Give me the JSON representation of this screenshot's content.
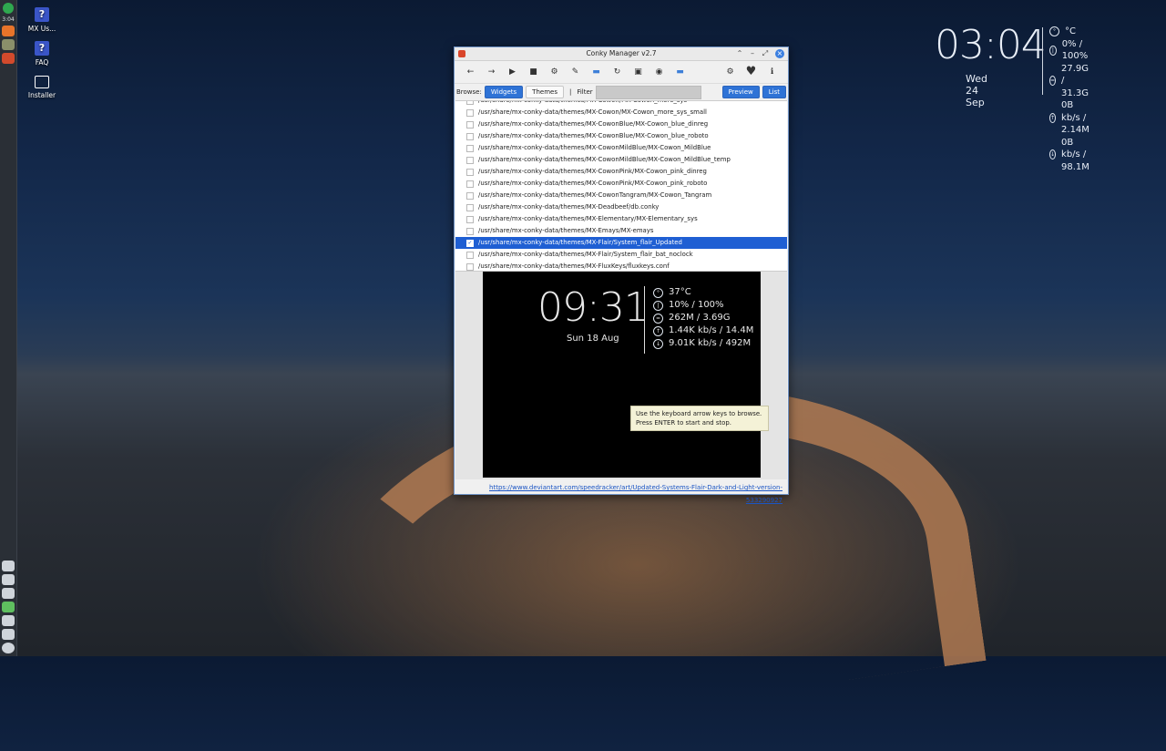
{
  "panel": {
    "clock": "3:04"
  },
  "desktop_icons": [
    {
      "label": "MX Us...",
      "glyph": "?"
    },
    {
      "label": "FAQ",
      "glyph": "?"
    },
    {
      "label": "Installer",
      "glyph": "installer-icon"
    }
  ],
  "conky": {
    "time": "03:04",
    "date": "Wed 24 Sep",
    "rows": [
      "°C",
      "0% / 100%",
      "27.9G / 31.3G",
      "0B kb/s / 2.14M",
      "0B kb/s / 98.1M"
    ]
  },
  "window": {
    "title": "Conky Manager v2.7",
    "browse_label": "Browse:",
    "widgets_label": "Widgets",
    "themes_label": "Themes",
    "separator": "|",
    "filter_label": "Filter",
    "filter_value": "",
    "preview_label": "Preview",
    "list_label": "List",
    "url": "https://www.deviantart.com/speedracker/art/Updated-Systems-Flair-Dark-and-Light-version-533290927",
    "themes": [
      {
        "path": "/usr/share/mx-conky-data/themes/MX-Cowon/MX-Cowon_more_sys",
        "checked": false
      },
      {
        "path": "/usr/share/mx-conky-data/themes/MX-Cowon/MX-Cowon_more_sys_small",
        "checked": false
      },
      {
        "path": "/usr/share/mx-conky-data/themes/MX-CowonBlue/MX-Cowon_blue_dinreg",
        "checked": false
      },
      {
        "path": "/usr/share/mx-conky-data/themes/MX-CowonBlue/MX-Cowon_blue_roboto",
        "checked": false
      },
      {
        "path": "/usr/share/mx-conky-data/themes/MX-CowonMildBlue/MX-Cowon_MildBlue",
        "checked": false
      },
      {
        "path": "/usr/share/mx-conky-data/themes/MX-CowonMildBlue/MX-Cowon_MildBlue_temp",
        "checked": false
      },
      {
        "path": "/usr/share/mx-conky-data/themes/MX-CowonPink/MX-Cowon_pink_dinreg",
        "checked": false
      },
      {
        "path": "/usr/share/mx-conky-data/themes/MX-CowonPink/MX-Cowon_pink_roboto",
        "checked": false
      },
      {
        "path": "/usr/share/mx-conky-data/themes/MX-CowonTangram/MX-Cowon_Tangram",
        "checked": false
      },
      {
        "path": "/usr/share/mx-conky-data/themes/MX-Deadbeef/db.conky",
        "checked": false
      },
      {
        "path": "/usr/share/mx-conky-data/themes/MX-Elementary/MX-Elementary_sys",
        "checked": false
      },
      {
        "path": "/usr/share/mx-conky-data/themes/MX-Emays/MX-emays",
        "checked": false
      },
      {
        "path": "/usr/share/mx-conky-data/themes/MX-Flair/System_flair_Updated",
        "checked": true
      },
      {
        "path": "/usr/share/mx-conky-data/themes/MX-Flair/System_flair_bat_noclock",
        "checked": false
      },
      {
        "path": "/usr/share/mx-conky-data/themes/MX-FluxKeys/fluxkeys.conf",
        "checked": false
      }
    ],
    "preview": {
      "time": "09:31",
      "date": "Sun 18 Aug",
      "rows": [
        "37°C",
        "10% / 100%",
        "262M / 3.69G",
        "1.44K kb/s / 14.4M",
        "9.01K kb/s / 492M"
      ],
      "tooltip_line1": "Use the keyboard arrow keys to browse.",
      "tooltip_line2": "Press ENTER to start and stop."
    }
  }
}
